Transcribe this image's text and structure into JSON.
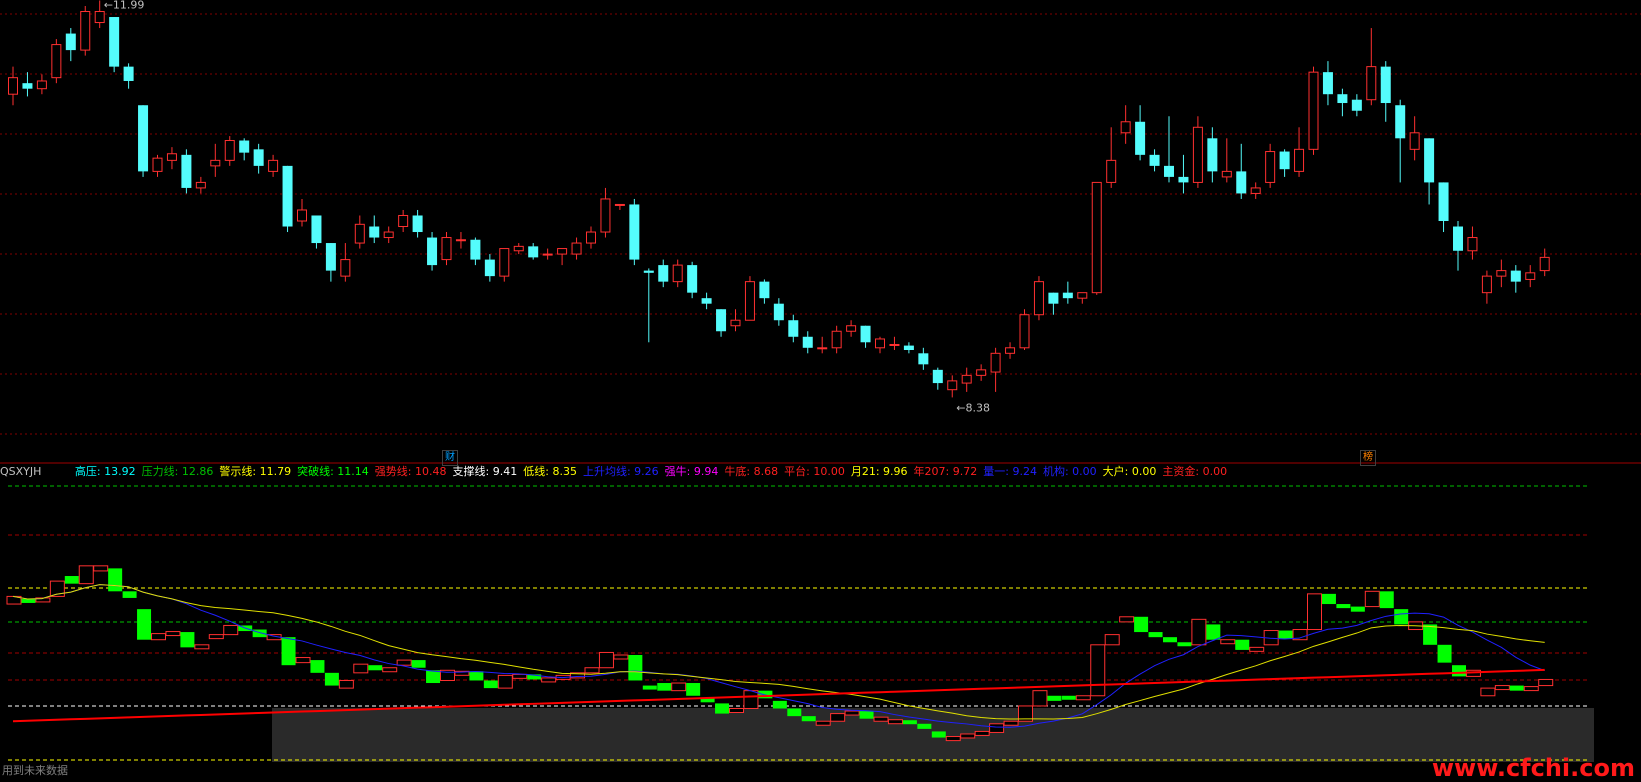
{
  "top_title": "",
  "price_high_label": "11.99",
  "price_low_label": "8.38",
  "markers": {
    "left": "财",
    "right": "榜"
  },
  "indicator": {
    "name": "QSXYJH",
    "items": [
      {
        "label": "高压:",
        "value": "13.92",
        "color": "#00ffff"
      },
      {
        "label": "压力线:",
        "value": "12.86",
        "color": "#00c000"
      },
      {
        "label": "警示线:",
        "value": "11.79",
        "color": "#ffff00"
      },
      {
        "label": "突破线:",
        "value": "11.14",
        "color": "#00ff00"
      },
      {
        "label": "强势线:",
        "value": "10.48",
        "color": "#ff2020"
      },
      {
        "label": "支撑线:",
        "value": "9.41",
        "color": "#ffffff"
      },
      {
        "label": "低线:",
        "value": "8.35",
        "color": "#ffff00"
      },
      {
        "label": "上升均线:",
        "value": "9.26",
        "color": "#2020ff"
      },
      {
        "label": "强牛:",
        "value": "9.94",
        "color": "#ff00ff"
      },
      {
        "label": "牛底:",
        "value": "8.68",
        "color": "#ff2020"
      },
      {
        "label": "平台:",
        "value": "10.00",
        "color": "#ff2020"
      },
      {
        "label": "月21:",
        "value": "9.96",
        "color": "#ffff00"
      },
      {
        "label": "年207:",
        "value": "9.72",
        "color": "#ff2020"
      },
      {
        "label": "量一:",
        "value": "9.24",
        "color": "#2020ff"
      },
      {
        "label": "机构:",
        "value": "0.00",
        "color": "#2020ff"
      },
      {
        "label": "大户:",
        "value": "0.00",
        "color": "#ffff00"
      },
      {
        "label": "主资金:",
        "value": "0.00",
        "color": "#ff2020"
      }
    ]
  },
  "footer_text": "用到未来数据",
  "watermark": "www.cfchi.com",
  "colors": {
    "up": "#ff3030",
    "down": "#54fcfc",
    "lower_up": "#ff3030",
    "lower_down": "#00ff00",
    "grid": "#800000",
    "ma_yellow": "#e0e000",
    "ma_blue": "#2020ff",
    "ma_red": "#ff0000"
  },
  "chart_data": {
    "type": "candlestick",
    "price_range": [
      8.2,
      12.1
    ],
    "candles": [
      [
        11.3,
        11.45,
        11.2,
        11.55
      ],
      [
        11.4,
        11.35,
        11.28,
        11.5
      ],
      [
        11.35,
        11.42,
        11.3,
        11.48
      ],
      [
        11.45,
        11.75,
        11.4,
        11.8
      ],
      [
        11.85,
        11.7,
        11.6,
        11.9
      ],
      [
        11.7,
        12.05,
        11.65,
        12.1
      ],
      [
        11.95,
        12.05,
        11.9,
        12.15
      ],
      [
        12.0,
        11.55,
        11.5,
        12.0
      ],
      [
        11.55,
        11.42,
        11.35,
        11.58
      ],
      [
        11.2,
        10.6,
        10.55,
        11.2
      ],
      [
        10.6,
        10.72,
        10.55,
        10.75
      ],
      [
        10.7,
        10.76,
        10.62,
        10.82
      ],
      [
        10.75,
        10.45,
        10.4,
        10.8
      ],
      [
        10.45,
        10.5,
        10.4,
        10.55
      ],
      [
        10.65,
        10.7,
        10.55,
        10.85
      ],
      [
        10.7,
        10.88,
        10.65,
        10.92
      ],
      [
        10.88,
        10.77,
        10.7,
        10.9
      ],
      [
        10.8,
        10.65,
        10.58,
        10.85
      ],
      [
        10.6,
        10.7,
        10.55,
        10.75
      ],
      [
        10.65,
        10.1,
        10.05,
        10.65
      ],
      [
        10.15,
        10.25,
        10.1,
        10.35
      ],
      [
        10.2,
        9.95,
        9.9,
        10.2
      ],
      [
        9.95,
        9.7,
        9.6,
        9.95
      ],
      [
        9.65,
        9.8,
        9.6,
        9.95
      ],
      [
        9.95,
        10.12,
        9.9,
        10.2
      ],
      [
        10.1,
        10.0,
        9.95,
        10.2
      ],
      [
        10.0,
        10.05,
        9.95,
        10.1
      ],
      [
        10.1,
        10.2,
        10.05,
        10.25
      ],
      [
        10.2,
        10.05,
        10.0,
        10.25
      ],
      [
        10.0,
        9.75,
        9.7,
        10.05
      ],
      [
        9.8,
        10.0,
        9.75,
        10.05
      ],
      [
        9.98,
        9.98,
        9.9,
        10.05
      ],
      [
        9.98,
        9.8,
        9.75,
        10.0
      ],
      [
        9.8,
        9.65,
        9.6,
        9.85
      ],
      [
        9.65,
        9.9,
        9.6,
        9.9
      ],
      [
        9.88,
        9.92,
        9.85,
        9.95
      ],
      [
        9.92,
        9.82,
        9.8,
        9.95
      ],
      [
        9.85,
        9.85,
        9.8,
        9.9
      ],
      [
        9.85,
        9.9,
        9.75,
        9.9
      ],
      [
        9.85,
        9.95,
        9.8,
        10.0
      ],
      [
        9.95,
        10.05,
        9.9,
        10.1
      ],
      [
        10.05,
        10.35,
        10.0,
        10.45
      ],
      [
        10.3,
        10.3,
        10.25,
        10.3
      ],
      [
        10.3,
        9.8,
        9.75,
        10.35
      ],
      [
        9.7,
        9.68,
        9.05,
        9.72
      ],
      [
        9.75,
        9.6,
        9.55,
        9.8
      ],
      [
        9.6,
        9.75,
        9.55,
        9.8
      ],
      [
        9.75,
        9.5,
        9.45,
        9.78
      ],
      [
        9.45,
        9.4,
        9.35,
        9.5
      ],
      [
        9.35,
        9.15,
        9.1,
        9.35
      ],
      [
        9.2,
        9.25,
        9.15,
        9.35
      ],
      [
        9.25,
        9.6,
        9.25,
        9.65
      ],
      [
        9.6,
        9.45,
        9.4,
        9.62
      ],
      [
        9.4,
        9.25,
        9.2,
        9.45
      ],
      [
        9.25,
        9.1,
        9.05,
        9.3
      ],
      [
        9.1,
        9.0,
        8.95,
        9.15
      ],
      [
        9.0,
        9.0,
        8.95,
        9.1
      ],
      [
        9.0,
        9.15,
        8.95,
        9.2
      ],
      [
        9.15,
        9.2,
        9.1,
        9.25
      ],
      [
        9.2,
        9.05,
        9.0,
        9.2
      ],
      [
        9.0,
        9.08,
        8.95,
        9.1
      ],
      [
        9.03,
        9.03,
        8.98,
        9.1
      ],
      [
        9.02,
        8.98,
        8.95,
        9.05
      ],
      [
        8.95,
        8.85,
        8.8,
        9.0
      ],
      [
        8.8,
        8.68,
        8.62,
        8.82
      ],
      [
        8.62,
        8.7,
        8.55,
        8.75
      ],
      [
        8.68,
        8.75,
        8.6,
        8.82
      ],
      [
        8.75,
        8.8,
        8.7,
        8.85
      ],
      [
        8.78,
        8.95,
        8.6,
        9.0
      ],
      [
        8.95,
        9.0,
        8.9,
        9.05
      ],
      [
        9.0,
        9.3,
        8.98,
        9.35
      ],
      [
        9.3,
        9.6,
        9.25,
        9.65
      ],
      [
        9.5,
        9.4,
        9.3,
        9.5
      ],
      [
        9.5,
        9.45,
        9.4,
        9.6
      ],
      [
        9.45,
        9.5,
        9.4,
        9.5
      ],
      [
        9.5,
        10.5,
        9.48,
        10.5
      ],
      [
        10.5,
        10.7,
        10.45,
        11.0
      ],
      [
        10.95,
        11.05,
        10.85,
        11.2
      ],
      [
        11.05,
        10.75,
        10.7,
        11.2
      ],
      [
        10.75,
        10.65,
        10.6,
        10.8
      ],
      [
        10.65,
        10.55,
        10.5,
        11.1
      ],
      [
        10.55,
        10.5,
        10.4,
        10.75
      ],
      [
        10.5,
        11.0,
        10.45,
        11.1
      ],
      [
        10.9,
        10.6,
        10.5,
        11.0
      ],
      [
        10.55,
        10.6,
        10.5,
        10.9
      ],
      [
        10.6,
        10.4,
        10.35,
        10.85
      ],
      [
        10.4,
        10.45,
        10.35,
        10.5
      ],
      [
        10.5,
        10.78,
        10.45,
        10.85
      ],
      [
        10.78,
        10.62,
        10.55,
        10.8
      ],
      [
        10.6,
        10.8,
        10.55,
        11.0
      ],
      [
        10.8,
        11.5,
        10.75,
        11.55
      ],
      [
        11.5,
        11.3,
        11.2,
        11.6
      ],
      [
        11.3,
        11.22,
        11.1,
        11.35
      ],
      [
        11.25,
        11.15,
        11.1,
        11.3
      ],
      [
        11.25,
        11.55,
        11.2,
        11.9
      ],
      [
        11.55,
        11.22,
        11.05,
        11.6
      ],
      [
        11.2,
        10.9,
        10.5,
        11.25
      ],
      [
        10.8,
        10.95,
        10.7,
        11.1
      ],
      [
        10.9,
        10.5,
        10.3,
        10.9
      ],
      [
        10.5,
        10.15,
        10.05,
        10.5
      ],
      [
        10.1,
        9.88,
        9.7,
        10.15
      ],
      [
        9.88,
        10.0,
        9.8,
        10.1
      ],
      [
        9.5,
        9.65,
        9.4,
        9.7
      ],
      [
        9.65,
        9.7,
        9.55,
        9.8
      ],
      [
        9.7,
        9.6,
        9.5,
        9.75
      ],
      [
        9.62,
        9.68,
        9.55,
        9.75
      ],
      [
        9.7,
        9.82,
        9.65,
        9.9
      ]
    ]
  }
}
